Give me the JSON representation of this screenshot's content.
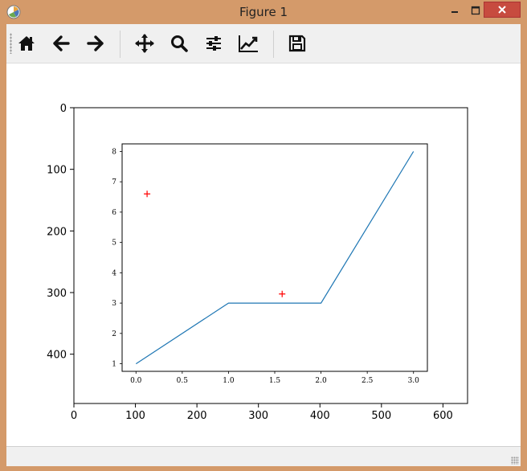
{
  "window": {
    "title": "Figure 1",
    "controls": {
      "minimize": "minimize",
      "maximize": "maximize",
      "close": "close"
    }
  },
  "toolbar": {
    "buttons": [
      {
        "name": "home-button",
        "icon": "home-icon"
      },
      {
        "name": "back-button",
        "icon": "arrow-left-icon"
      },
      {
        "name": "forward-button",
        "icon": "arrow-right-icon"
      },
      {
        "name": "pan-button",
        "icon": "move-icon"
      },
      {
        "name": "zoom-button",
        "icon": "magnifier-icon"
      },
      {
        "name": "subplots-button",
        "icon": "sliders-icon"
      },
      {
        "name": "edit-axes-button",
        "icon": "line-chart-icon"
      },
      {
        "name": "save-button",
        "icon": "floppy-disk-icon"
      }
    ]
  },
  "status": {
    "text": ""
  },
  "chart_data": [
    {
      "type": "image",
      "x_ticks": [
        "0",
        "100",
        "200",
        "300",
        "400",
        "500",
        "600"
      ],
      "y_ticks": [
        "0",
        "100",
        "200",
        "300",
        "400"
      ],
      "xlim": [
        0,
        640
      ],
      "ylim": [
        480,
        0
      ],
      "grid": false
    },
    {
      "type": "line",
      "x": [
        0.0,
        1.0,
        2.0,
        3.0
      ],
      "y": [
        1,
        3,
        3,
        8
      ],
      "line_color": "#1f77b4",
      "markers": {
        "x": [
          0.12,
          1.58
        ],
        "y": [
          6.6,
          3.3
        ],
        "symbol": "+",
        "color": "#ff0000"
      },
      "x_ticks": [
        "0.0",
        "0.5",
        "1.0",
        "1.5",
        "2.0",
        "2.5",
        "3.0"
      ],
      "y_ticks": [
        "1",
        "2",
        "3",
        "4",
        "5",
        "6",
        "7",
        "8"
      ],
      "xlim": [
        -0.15,
        3.15
      ],
      "ylim": [
        0.75,
        8.25
      ],
      "grid": false
    }
  ]
}
